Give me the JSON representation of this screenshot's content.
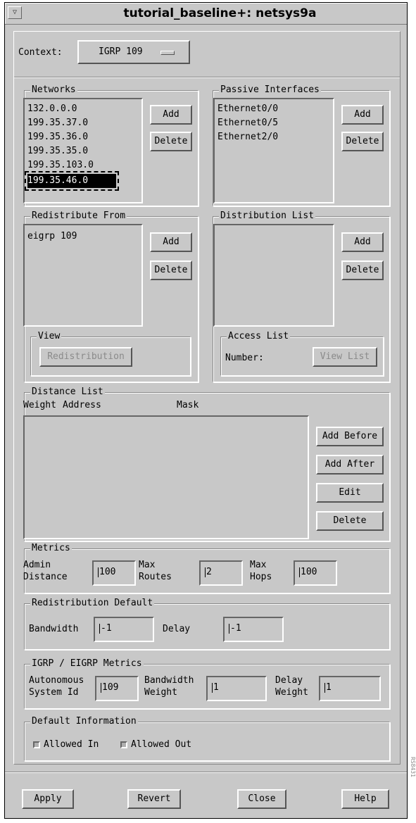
{
  "window": {
    "title": "tutorial_baseline+: netsys9a",
    "menu_glyph": "▽"
  },
  "context": {
    "label": "Context:",
    "value": "IGRP 109"
  },
  "networks": {
    "legend": "Networks",
    "items": [
      "132.0.0.0",
      "199.35.37.0",
      "199.35.36.0",
      "199.35.35.0",
      "199.35.103.0",
      "199.35.46.0"
    ],
    "selected_index": 5,
    "add_label": "Add",
    "delete_label": "Delete"
  },
  "passive": {
    "legend": "Passive Interfaces",
    "items": [
      "Ethernet0/0",
      "Ethernet0/5",
      "Ethernet2/0"
    ],
    "add_label": "Add",
    "delete_label": "Delete"
  },
  "redistribute": {
    "legend": "Redistribute From",
    "items": [
      "eigrp 109"
    ],
    "add_label": "Add",
    "delete_label": "Delete",
    "view_legend": "View",
    "view_button": "Redistribution"
  },
  "distribution": {
    "legend": "Distribution List",
    "add_label": "Add",
    "delete_label": "Delete",
    "access_legend": "Access List",
    "number_label": "Number:",
    "view_list_button": "View List"
  },
  "distance": {
    "legend": "Distance List",
    "columns": [
      "Weight",
      "Address",
      "Mask"
    ],
    "buttons": [
      "Add Before",
      "Add After",
      "Edit",
      "Delete"
    ]
  },
  "metrics": {
    "legend": "Metrics",
    "admin_label": [
      "Admin",
      "Distance"
    ],
    "admin_value": "100",
    "routes_label": [
      "Max",
      "Routes"
    ],
    "routes_value": "2",
    "hops_label": [
      "Max",
      "Hops"
    ],
    "hops_value": "100"
  },
  "redist_default": {
    "legend": "Redistribution Default",
    "bandwidth_label": "Bandwidth",
    "bandwidth_value": "-1",
    "delay_label": "Delay",
    "delay_value": "-1"
  },
  "igrp": {
    "legend": "IGRP / EIGRP Metrics",
    "asid_label": [
      "Autonomous",
      "System Id"
    ],
    "asid_value": "109",
    "bw_label": [
      "Bandwidth",
      "Weight"
    ],
    "bw_value": "1",
    "delay_label": [
      "Delay",
      "Weight"
    ],
    "delay_value": "1"
  },
  "default_info": {
    "legend": "Default Information",
    "allowed_in": "Allowed In",
    "allowed_out": "Allowed Out"
  },
  "footer": {
    "apply": "Apply",
    "revert": "Revert",
    "close": "Close",
    "help": "Help"
  },
  "side_text": "RS8431"
}
